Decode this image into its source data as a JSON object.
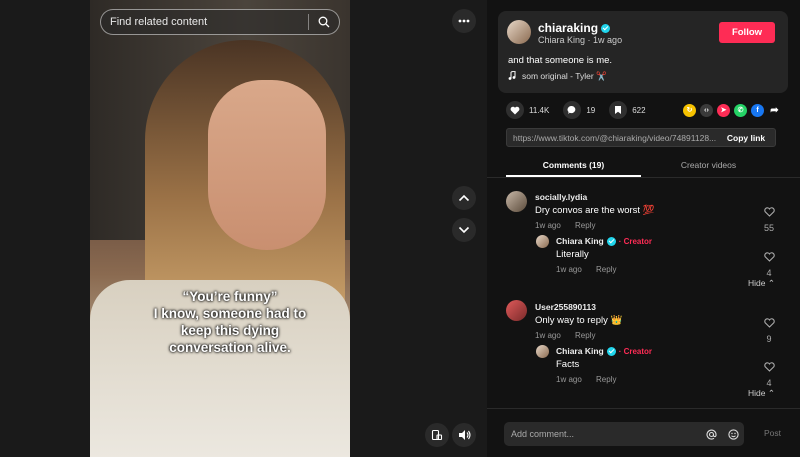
{
  "search": {
    "placeholder": "Find related content"
  },
  "video": {
    "caption_line1": "“You’re funny”",
    "caption_line2": "I know, someone had to",
    "caption_line3": "keep this dying",
    "caption_line4": "conversation alive."
  },
  "author": {
    "username": "chiaraking",
    "display_name": "Chiara King",
    "posted": "1w ago",
    "follow_label": "Follow",
    "description": "and that someone is me.",
    "music": "som original - Tyler ✂️"
  },
  "stats": {
    "likes": "11.4K",
    "comments": "19",
    "saves": "622"
  },
  "share": {
    "url": "https://www.tiktok.com/@chiaraking/video/74891128...",
    "copy_label": "Copy link"
  },
  "tabs": {
    "comments": "Comments (19)",
    "creator_videos": "Creator videos"
  },
  "comments": [
    {
      "user": "socially.lydia",
      "text": "Dry convos are the worst 💯",
      "time": "1w ago",
      "reply_label": "Reply",
      "likes": "55",
      "reply": {
        "user": "Chiara King",
        "creator_label": "· Creator",
        "text": "Literally",
        "time": "1w ago",
        "reply_label": "Reply",
        "likes": "4"
      },
      "hide_label": "Hide"
    },
    {
      "user": "User255890113",
      "text": "Only way to reply 👑",
      "time": "1w ago",
      "reply_label": "Reply",
      "likes": "9",
      "reply": {
        "user": "Chiara King",
        "creator_label": "· Creator",
        "text": "Facts",
        "time": "1w ago",
        "reply_label": "Reply",
        "likes": "4"
      },
      "hide_label": "Hide"
    }
  ],
  "composer": {
    "placeholder": "Add comment...",
    "post_label": "Post"
  },
  "colors": {
    "accent": "#fe2c55",
    "verified": "#20d5ec",
    "background": "#121212"
  }
}
